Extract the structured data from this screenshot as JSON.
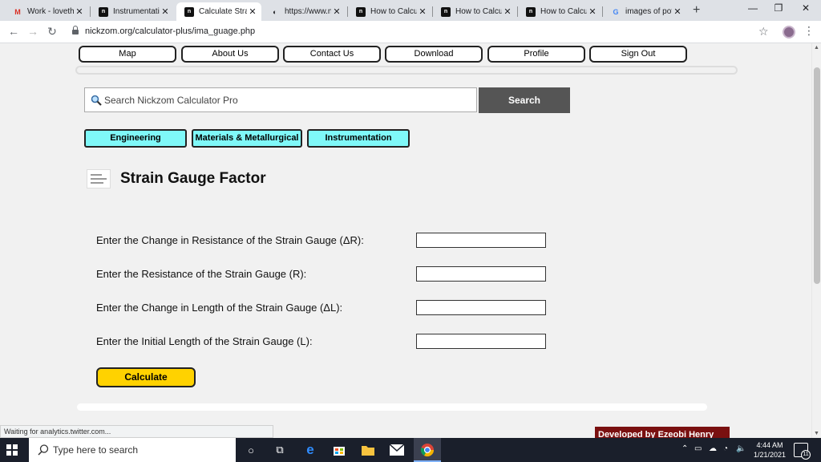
{
  "browser": {
    "tabs": [
      {
        "title": "Work - lovethi",
        "icon": "gmail-icon",
        "glyph": "M",
        "color": "#d93025"
      },
      {
        "title": "Instrumentatio",
        "icon": "nickzom-icon",
        "glyph": "n"
      },
      {
        "title": "Calculate Strai",
        "icon": "nickzom-icon",
        "glyph": "n",
        "active": true
      },
      {
        "title": "https://www.ni",
        "icon": "loading-icon",
        "glyph": "◐"
      },
      {
        "title": "How to Calcula",
        "icon": "nickzom-icon",
        "glyph": "n"
      },
      {
        "title": "How to Calcula",
        "icon": "nickzom-icon",
        "glyph": "n"
      },
      {
        "title": "How to Calcula",
        "icon": "nickzom-icon",
        "glyph": "n"
      },
      {
        "title": "images of pot",
        "icon": "google-icon",
        "glyph": "G",
        "color": "#4285f4"
      }
    ],
    "url": "nickzom.org/calculator-plus/ima_guage.php",
    "status": "Waiting for analytics.twitter.com..."
  },
  "nav": {
    "links": [
      "Map",
      "About Us",
      "Contact Us",
      "Download",
      "Profile",
      "Sign Out"
    ]
  },
  "search": {
    "placeholder": "Search Nickzom Calculator Pro",
    "button": "Search"
  },
  "categories": [
    "Engineering",
    "Materials & Metallurgical",
    "Instrumentation"
  ],
  "page": {
    "title": "Strain Gauge Factor"
  },
  "form": {
    "fields": [
      {
        "label": "Enter the Change in Resistance of the Strain Gauge (ΔR):",
        "value": ""
      },
      {
        "label": "Enter the Resistance of the Strain Gauge (R):",
        "value": ""
      },
      {
        "label": "Enter the Change in Length of the Strain Gauge (ΔL):",
        "value": ""
      },
      {
        "label": "Enter the Initial Length of the Strain Gauge (L):",
        "value": ""
      }
    ],
    "submit": "Calculate"
  },
  "footer": {
    "credit": "Developed by Ezeobi Henry"
  },
  "taskbar": {
    "search_placeholder": "Type here to search",
    "time": "4:44 AM",
    "date": "1/21/2021",
    "notification_count": "11"
  },
  "colors": {
    "category_bg": "#7ff8f8",
    "calculate_bg": "#ffd200",
    "search_btn_bg": "#555555",
    "credit_bg": "#7a1010"
  }
}
